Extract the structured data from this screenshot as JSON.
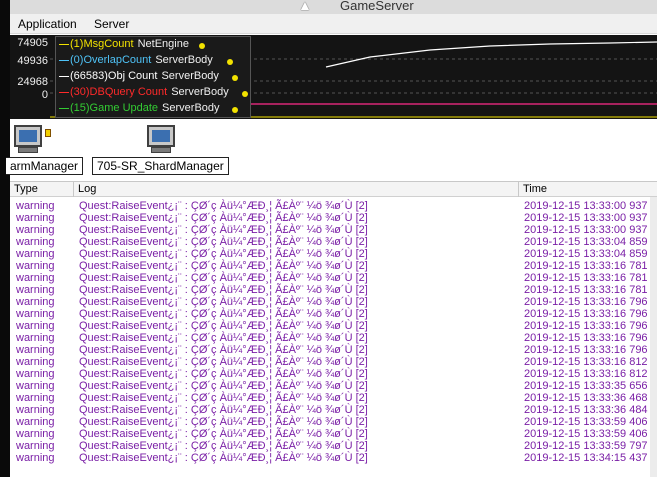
{
  "window": {
    "title": "GameServer"
  },
  "menu": [
    "Application",
    "Server"
  ],
  "graph": {
    "y_labels": [
      "74905",
      "49936",
      "24968",
      "0"
    ],
    "legend": [
      {
        "label": "(1)MsgCount",
        "source": "NetEngine",
        "color": "#f2e200"
      },
      {
        "label": "(0)OverlapCount",
        "source": "ServerBody",
        "color": "#4fc3f7"
      },
      {
        "label": "(66583)Obj Count",
        "source": "ServerBody",
        "color": "#ffffff"
      },
      {
        "label": "(30)DBQuery Count",
        "source": "ServerBody",
        "color": "#ff2a2a"
      },
      {
        "label": "(15)Game Update",
        "source": "ServerBody",
        "color": "#33cc33"
      }
    ]
  },
  "agents": [
    {
      "label": "armManager"
    },
    {
      "label": "705-SR_ShardManager"
    }
  ],
  "log": {
    "columns": [
      "Type",
      "Log",
      "Time"
    ],
    "rows": [
      {
        "type": "warning",
        "message": "Quest:RaiseEvent¿¡¨ : ÇØ´ç Àü¼°ÆÐ¸¦ Ã£Àº¨ ¼ö ¾ø´Ù [2]",
        "time": "2019-12-15 13:33:00 937"
      },
      {
        "type": "warning",
        "message": "Quest:RaiseEvent¿¡¨ : ÇØ´ç Àü¼°ÆÐ¸¦ Ã£Àº¨ ¼ö ¾ø´Ù [2]",
        "time": "2019-12-15 13:33:00 937"
      },
      {
        "type": "warning",
        "message": "Quest:RaiseEvent¿¡¨ : ÇØ´ç Àü¼°ÆÐ¸¦ Ã£Àº¨ ¼ö ¾ø´Ù [2]",
        "time": "2019-12-15 13:33:00 937"
      },
      {
        "type": "warning",
        "message": "Quest:RaiseEvent¿¡¨ : ÇØ´ç Àü¼°ÆÐ¸¦ Ã£Àº¨ ¼ö ¾ø´Ù [2]",
        "time": "2019-12-15 13:33:04 859"
      },
      {
        "type": "warning",
        "message": "Quest:RaiseEvent¿¡¨ : ÇØ´ç Àü¼°ÆÐ¸¦ Ã£Àº¨ ¼ö ¾ø´Ù [2]",
        "time": "2019-12-15 13:33:04 859"
      },
      {
        "type": "warning",
        "message": "Quest:RaiseEvent¿¡¨ : ÇØ´ç Àü¼°ÆÐ¸¦ Ã£Àº¨ ¼ö ¾ø´Ù [2]",
        "time": "2019-12-15 13:33:16 781"
      },
      {
        "type": "warning",
        "message": "Quest:RaiseEvent¿¡¨ : ÇØ´ç Àü¼°ÆÐ¸¦ Ã£Àº¨ ¼ö ¾ø´Ù [2]",
        "time": "2019-12-15 13:33:16 781"
      },
      {
        "type": "warning",
        "message": "Quest:RaiseEvent¿¡¨ : ÇØ´ç Àü¼°ÆÐ¸¦ Ã£Àº¨ ¼ö ¾ø´Ù [2]",
        "time": "2019-12-15 13:33:16 781"
      },
      {
        "type": "warning",
        "message": "Quest:RaiseEvent¿¡¨ : ÇØ´ç Àü¼°ÆÐ¸¦ Ã£Àº¨ ¼ö ¾ø´Ù [2]",
        "time": "2019-12-15 13:33:16 796"
      },
      {
        "type": "warning",
        "message": "Quest:RaiseEvent¿¡¨ : ÇØ´ç Àü¼°ÆÐ¸¦ Ã£Àº¨ ¼ö ¾ø´Ù [2]",
        "time": "2019-12-15 13:33:16 796"
      },
      {
        "type": "warning",
        "message": "Quest:RaiseEvent¿¡¨ : ÇØ´ç Àü¼°ÆÐ¸¦ Ã£Àº¨ ¼ö ¾ø´Ù [2]",
        "time": "2019-12-15 13:33:16 796"
      },
      {
        "type": "warning",
        "message": "Quest:RaiseEvent¿¡¨ : ÇØ´ç Àü¼°ÆÐ¸¦ Ã£Àº¨ ¼ö ¾ø´Ù [2]",
        "time": "2019-12-15 13:33:16 796"
      },
      {
        "type": "warning",
        "message": "Quest:RaiseEvent¿¡¨ : ÇØ´ç Àü¼°ÆÐ¸¦ Ã£Àº¨ ¼ö ¾ø´Ù [2]",
        "time": "2019-12-15 13:33:16 796"
      },
      {
        "type": "warning",
        "message": "Quest:RaiseEvent¿¡¨ : ÇØ´ç Àü¼°ÆÐ¸¦ Ã£Àº¨ ¼ö ¾ø´Ù [2]",
        "time": "2019-12-15 13:33:16 812"
      },
      {
        "type": "warning",
        "message": "Quest:RaiseEvent¿¡¨ : ÇØ´ç Àü¼°ÆÐ¸¦ Ã£Àº¨ ¼ö ¾ø´Ù [2]",
        "time": "2019-12-15 13:33:16 812"
      },
      {
        "type": "warning",
        "message": "Quest:RaiseEvent¿¡¨ : ÇØ´ç Àü¼°ÆÐ¸¦ Ã£Àº¨ ¼ö ¾ø´Ù [2]",
        "time": "2019-12-15 13:33:35 656"
      },
      {
        "type": "warning",
        "message": "Quest:RaiseEvent¿¡¨ : ÇØ´ç Àü¼°ÆÐ¸¦ Ã£Àº¨ ¼ö ¾ø´Ù [2]",
        "time": "2019-12-15 13:33:36 468"
      },
      {
        "type": "warning",
        "message": "Quest:RaiseEvent¿¡¨ : ÇØ´ç Àü¼°ÆÐ¸¦ Ã£Àº¨ ¼ö ¾ø´Ù [2]",
        "time": "2019-12-15 13:33:36 484"
      },
      {
        "type": "warning",
        "message": "Quest:RaiseEvent¿¡¨ : ÇØ´ç Àü¼°ÆÐ¸¦ Ã£Àº¨ ¼ö ¾ø´Ù [2]",
        "time": "2019-12-15 13:33:59 406"
      },
      {
        "type": "warning",
        "message": "Quest:RaiseEvent¿¡¨ : ÇØ´ç Àü¼°ÆÐ¸¦ Ã£Àº¨ ¼ö ¾ø´Ù [2]",
        "time": "2019-12-15 13:33:59 406"
      },
      {
        "type": "warning",
        "message": "Quest:RaiseEvent¿¡¨ : ÇØ´ç Àü¼°ÆÐ¸¦ Ã£Àº¨ ¼ö ¾ø´Ù [2]",
        "time": "2019-12-15 13:33:59 797"
      },
      {
        "type": "warning",
        "message": "Quest:RaiseEvent¿¡¨ : ÇØ´ç Àü¼°ÆÐ¸¦ Ã£Àº¨ ¼ö ¾ø´Ù [2]",
        "time": "2019-12-15 13:34:15 437"
      }
    ]
  }
}
